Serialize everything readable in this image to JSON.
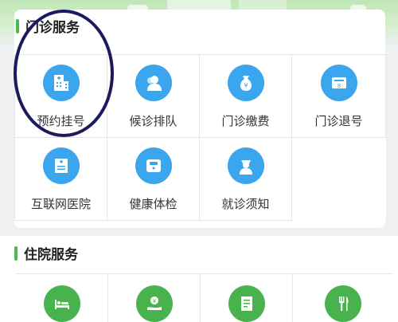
{
  "colors": {
    "accent_green": "#4cbb4a",
    "icon_blue": "#3ba6ee",
    "icon_green": "#48b24f",
    "annotation": "#1c1a5e"
  },
  "outpatient": {
    "title": "门诊服务",
    "items": [
      {
        "label": "预约挂号",
        "icon": "hospital-building-icon"
      },
      {
        "label": "候诊排队",
        "icon": "queue-person-icon"
      },
      {
        "label": "门诊缴费",
        "icon": "money-bag-icon"
      },
      {
        "label": "门诊退号",
        "icon": "ticket-refund-icon"
      },
      {
        "label": "互联网医院",
        "icon": "online-hospital-icon"
      },
      {
        "label": "健康体检",
        "icon": "weight-scale-icon"
      },
      {
        "label": "就诊须知",
        "icon": "doctor-notice-icon"
      }
    ]
  },
  "inpatient": {
    "title": "住院服务",
    "items": [
      {
        "icon": "hospital-bed-icon"
      },
      {
        "icon": "deposit-hand-icon"
      },
      {
        "icon": "bill-list-icon"
      },
      {
        "icon": "meal-fork-knife-icon"
      }
    ]
  }
}
